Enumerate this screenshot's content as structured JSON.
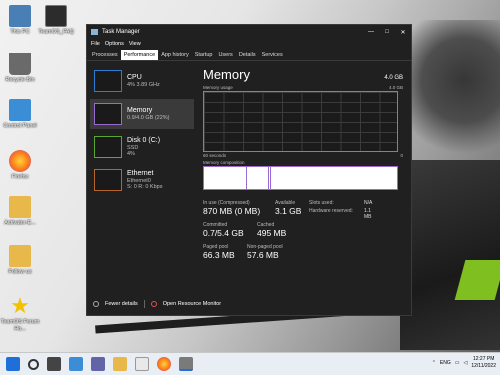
{
  "desktop": {
    "icons": [
      {
        "label": "This PC",
        "color": "#4a7fb5"
      },
      {
        "label": "TeamOS_FAQ",
        "color": "#2c2c2c"
      },
      {
        "label": "Recycle Bin",
        "color": "#6a6a6a"
      },
      {
        "label": "Control Panel",
        "color": "#3b8dd6"
      },
      {
        "label": "Firefox",
        "color": "#ff7a1a"
      },
      {
        "label": "Activator-E...",
        "color": "#e8b84a"
      },
      {
        "label": "Follow us",
        "color": "#e8b84a"
      },
      {
        "label": "TeamOS Forum Ho...",
        "color": "#f2c200"
      }
    ]
  },
  "window": {
    "title": "Task Manager",
    "minimize": "—",
    "maximize": "□",
    "close": "✕",
    "menu": [
      "File",
      "Options",
      "View"
    ],
    "tabs": [
      "Processes",
      "Performance",
      "App history",
      "Startup",
      "Users",
      "Details",
      "Services"
    ],
    "active_tab": "Performance"
  },
  "devices": [
    {
      "name": "CPU",
      "sub1": "4% 3.89 GHz",
      "sub2": "",
      "color": "#2f7bd1"
    },
    {
      "name": "Memory",
      "sub1": "0.9/4.0 GB (22%)",
      "sub2": "",
      "color": "#9b6ad1"
    },
    {
      "name": "Disk 0 (C:)",
      "sub1": "SSD",
      "sub2": "4%",
      "color": "#5aa832"
    },
    {
      "name": "Ethernet",
      "sub1": "Ethernet0",
      "sub2": "S: 0 R: 0 Kbps",
      "color": "#b5652a"
    }
  ],
  "memory": {
    "title": "Memory",
    "capacity": "4.0 GB",
    "usage_label": "Memory usage",
    "usage_max": "4.0 GB",
    "time_left": "60 seconds",
    "time_right": "0",
    "composition_label": "Memory composition",
    "stats": {
      "in_use_label": "In use (Compressed)",
      "in_use": "870 MB (0 MB)",
      "available_label": "Available",
      "available": "3.1 GB",
      "committed_label": "Committed",
      "committed": "0.7/5.4 GB",
      "cached_label": "Cached",
      "cached": "495 MB",
      "paged_label": "Paged pool",
      "paged": "66.3 MB",
      "nonpaged_label": "Non-paged pool",
      "nonpaged": "57.6 MB",
      "slots_label": "Slots used:",
      "slots": "N/A",
      "hw_label": "Hardware reserved:",
      "hw": "1.1 MB"
    }
  },
  "footer": {
    "fewer": "Fewer details",
    "monitor": "Open Resource Monitor"
  },
  "taskbar": {
    "lang": "ENG",
    "time": "12:27 PM",
    "date": "12/11/2022"
  }
}
